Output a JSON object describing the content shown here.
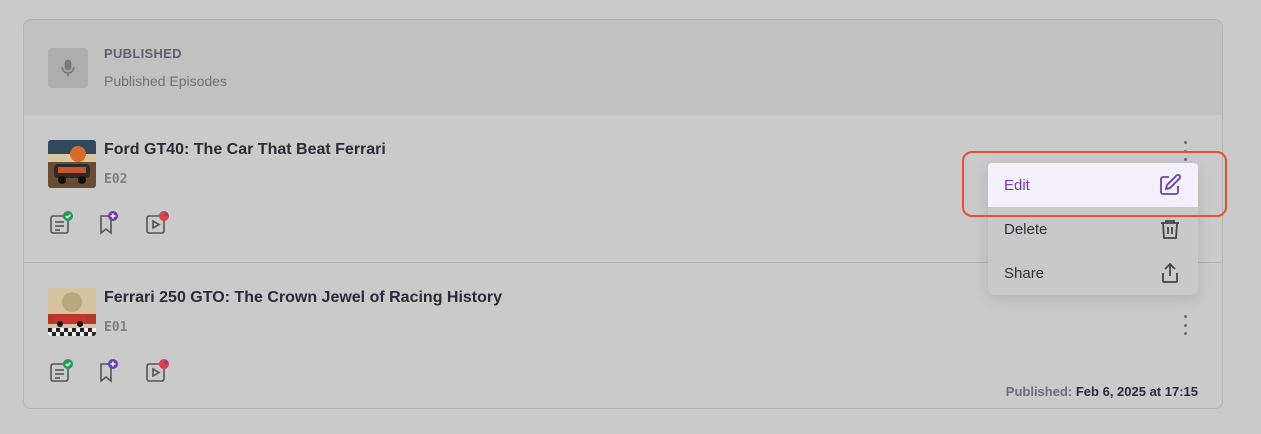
{
  "header": {
    "title": "PUBLISHED",
    "subtitle": "Published Episodes",
    "icon": "microphone-icon"
  },
  "episodes": [
    {
      "title": "Ford GT40: The Car That Beat Ferrari",
      "number": "E02",
      "published_label": "",
      "published_value": ""
    },
    {
      "title": "Ferrari 250 GTO: The Crown Jewel of Racing History",
      "number": "E01",
      "published_label": "Published:",
      "published_value": "Feb 6, 2025 at 17:15"
    }
  ],
  "menu": {
    "items": [
      {
        "label": "Edit",
        "icon": "edit-icon"
      },
      {
        "label": "Delete",
        "icon": "trash-icon"
      },
      {
        "label": "Share",
        "icon": "share-icon"
      }
    ]
  },
  "colors": {
    "accent": "#6b3fb0",
    "highlight": "#e2522c",
    "check_green": "#1f9d55",
    "badge_red": "#e0413a"
  }
}
